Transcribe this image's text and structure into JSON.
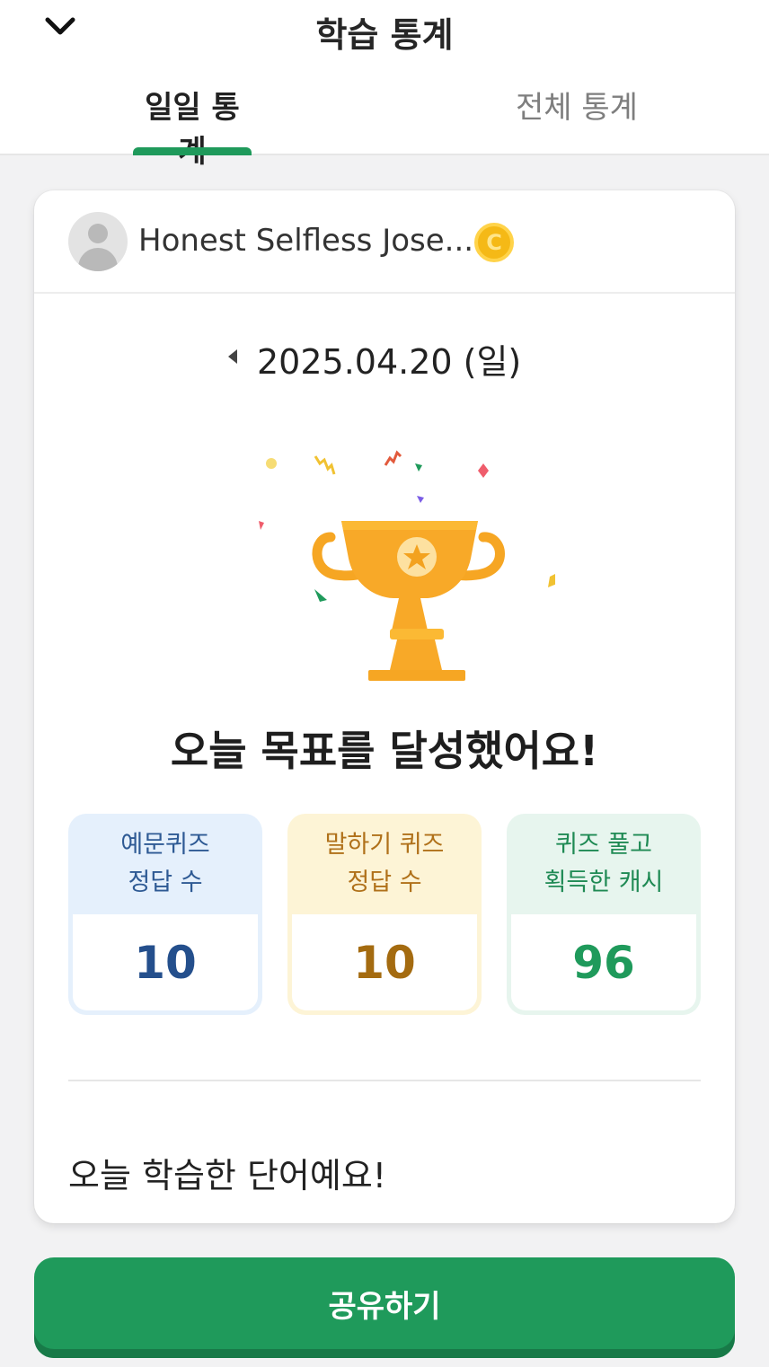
{
  "header": {
    "title": "학습 통계",
    "back_icon": "chevron-down-icon"
  },
  "tabs": [
    {
      "label": "일일 통계",
      "active": true
    },
    {
      "label": "전체 통계",
      "active": false
    }
  ],
  "profile": {
    "name": "Honest Selfless Jose...",
    "avatar_icon": "default-avatar-icon",
    "badge_icon": "coin-icon",
    "badge_letter": "C"
  },
  "date_nav": {
    "date": "2025.04.20 (일)",
    "prev_icon": "triangle-left-icon"
  },
  "achievement": {
    "icon": "trophy-icon",
    "message": "오늘 목표를 달성했어요!"
  },
  "stats": [
    {
      "label": "예문퀴즈\n정답 수",
      "value": "10",
      "color": "#244f8c"
    },
    {
      "label": "말하기 퀴즈\n정답 수",
      "value": "10",
      "color": "#a46b10"
    },
    {
      "label": "퀴즈 풀고\n획득한 캐시",
      "value": "96",
      "color": "#1f9a5b"
    }
  ],
  "words_section": {
    "title": "오늘 학습한 단어예요!"
  },
  "share_button": {
    "label": "공유하기"
  },
  "colors": {
    "accent": "#1f9a5b",
    "background": "#f2f2f3",
    "coin": "#f5b916",
    "trophy": "#f8a928"
  }
}
